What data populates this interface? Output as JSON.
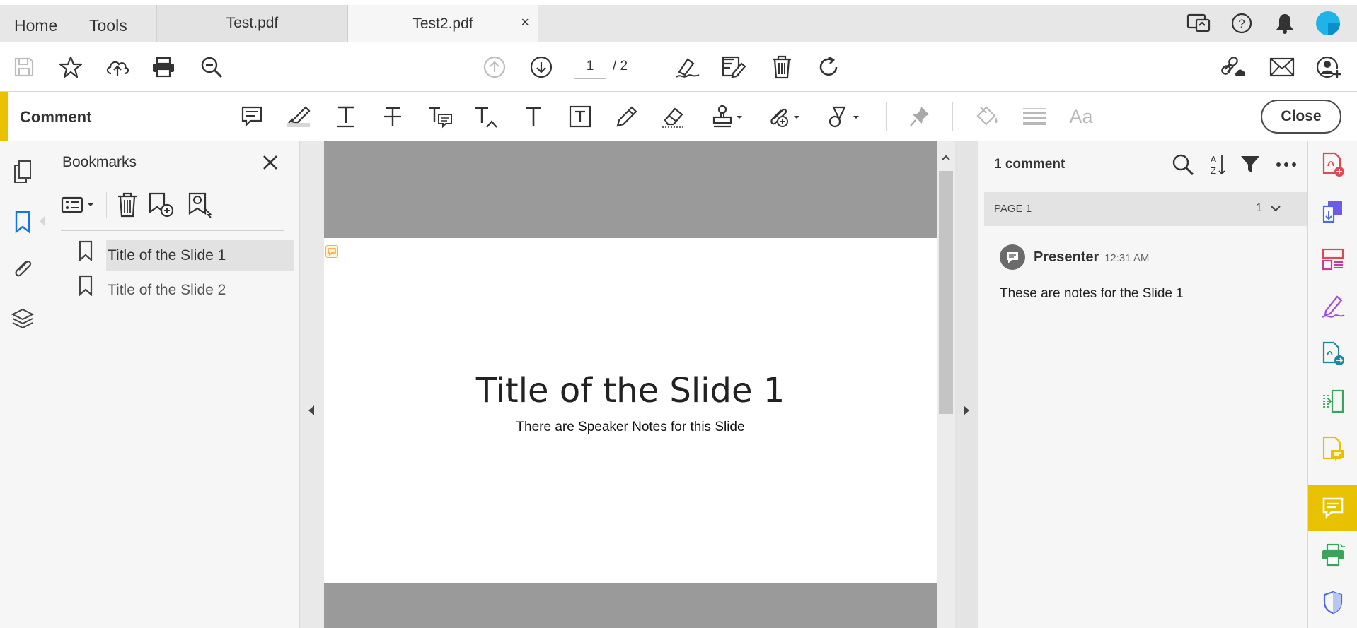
{
  "topbar": {
    "home": "Home",
    "tools": "Tools",
    "tabs": [
      {
        "label": "Test.pdf",
        "active": false
      },
      {
        "label": "Test2.pdf",
        "active": true
      }
    ],
    "close_glyph": "×"
  },
  "toolbar": {
    "current_page": "1",
    "total_pages": "/ 2"
  },
  "commentbar": {
    "title": "Comment",
    "close_label": "Close",
    "accent_color": "#e8c200",
    "sample_text_tool": "Aa"
  },
  "bookmarks": {
    "title": "Bookmarks",
    "items": [
      {
        "label": "Title of the Slide 1",
        "selected": true
      },
      {
        "label": "Title of the Slide 2",
        "selected": false
      }
    ]
  },
  "page": {
    "title": "Title of the Slide 1",
    "subtitle": "There are Speaker Notes for this Slide"
  },
  "comments": {
    "count_label": "1 comment",
    "page_label": "PAGE 1",
    "page_count": "1",
    "items": [
      {
        "author": "Presenter",
        "time": "12:31 AM",
        "text": "These are notes for the Slide 1"
      }
    ]
  }
}
